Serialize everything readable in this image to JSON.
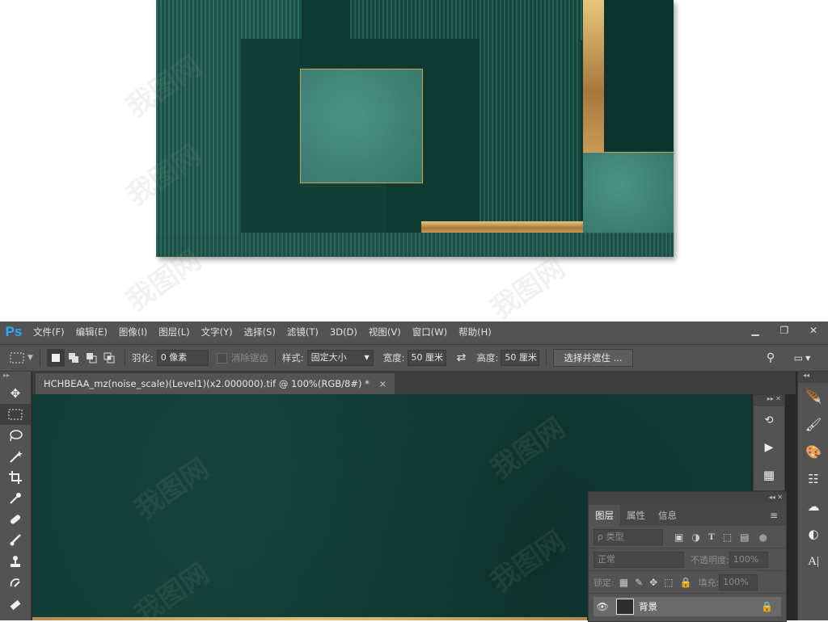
{
  "menubar": {
    "logo": "Ps",
    "items": [
      "文件(F)",
      "编辑(E)",
      "图像(I)",
      "图层(L)",
      "文字(Y)",
      "选择(S)",
      "滤镜(T)",
      "3D(D)",
      "视图(V)",
      "窗口(W)",
      "帮助(H)"
    ]
  },
  "options": {
    "feather_label": "羽化:",
    "feather_value": "0 像素",
    "antialias_label": "消除锯齿",
    "style_label": "样式:",
    "style_value": "固定大小",
    "width_label": "宽度:",
    "width_value": "50 厘米",
    "height_label": "高度:",
    "height_value": "50 厘米",
    "select_mask_label": "选择并遮住 ..."
  },
  "document": {
    "tab_title": "HCHBEAA_mz(noise_scale)(Level1)(x2.000000).tif @ 100%(RGB/8#) *",
    "close_glyph": "×"
  },
  "layers_panel": {
    "tabs": [
      "图层",
      "属性",
      "信息"
    ],
    "active_tab": "图层",
    "filter_placeholder": "ρ 类型",
    "blend_mode": "正常",
    "opacity_label": "不透明度:",
    "opacity_value": "100%",
    "lock_label": "锁定:",
    "fill_label": "填充:",
    "fill_value": "100%",
    "layer_name": "背景"
  },
  "colors": {
    "ps_blue": "#31a8ff",
    "panel": "#535353",
    "canvas_green": "#113c34",
    "gold": "#d4b06a"
  },
  "icons": [
    "move-icon",
    "marquee-icon",
    "lasso-icon",
    "magic-wand-icon",
    "crop-icon",
    "eyedropper-icon",
    "healing-icon",
    "brush-icon",
    "stamp-icon",
    "history-brush-icon",
    "eraser-icon"
  ]
}
